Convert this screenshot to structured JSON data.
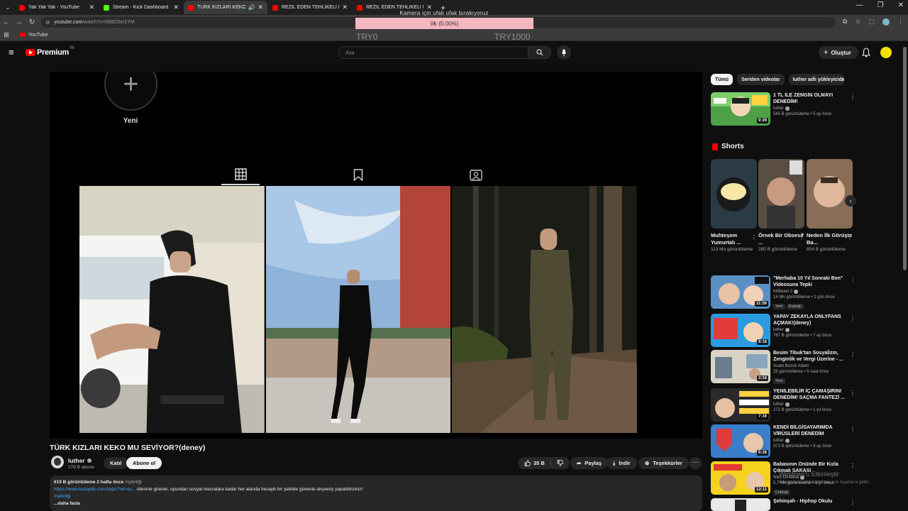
{
  "browser": {
    "tabs": [
      {
        "title": "Yak Yak Yak - YouTube",
        "favicon": "youtube-icon",
        "active": false
      },
      {
        "title": "Stream - Kick Dashboard",
        "favicon": "kick-icon",
        "active": false
      },
      {
        "title": "TÜRK KIZLARI KEKO MU SE",
        "favicon": "youtube-icon",
        "active": true
      },
      {
        "title": "REZİL EDEN TEHLİKELİ MASA O",
        "favicon": "youtube-icon",
        "active": false
      },
      {
        "title": "REZİL EDEN TEHLİKELİ MASA O",
        "favicon": "youtube-icon",
        "active": false
      }
    ],
    "url_host": "youtube.com",
    "url_path": "/watch?v=hf8825eI1YM",
    "bookmark": "YouTube"
  },
  "overlay": {
    "hint": "Kamera için ufak ufak bırakıyoruz",
    "progress_text": "0₺ (0.00%)",
    "progress_fraction": 0.0,
    "left_label": "TRY0",
    "right_label": "TRY1000"
  },
  "header": {
    "logo_text": "Premium",
    "logo_region": "TR",
    "search_placeholder": "Ara",
    "create_label": "Oluştur"
  },
  "player": {
    "new_label": "Yeni"
  },
  "video": {
    "title": "TÜRK KIZLARI KEKO MU SEVİYOR?(deney)",
    "channel": "luther",
    "subscribers": "279 B abone",
    "join_label": "Katıl",
    "subscribe_label": "Abone ol",
    "likes": "35 B",
    "share_label": "Paylaş",
    "download_label": "İndir",
    "thanks_label": "Teşekkürler",
    "views_date": "619 B görüntüleme  2 hafta önce",
    "hashtag": "#işbirliği",
    "desc_link": "https://www.hesaptik.com/login?ref=tu...",
    "desc_text": " sitesine girerek, oyundan sosyal mecralara kadar her alanda hesaplı bir şekilde güvenle alışveriş yapabilirsiniz!",
    "desc_hashtag2": "#işbirliği",
    "more_label": "...daha fazla"
  },
  "sidebar": {
    "chips": [
      "Tümü",
      "Seriden videolar",
      "luther adlı yükleyiciden"
    ],
    "top_rec": {
      "title": "1 TL İLE ZENGİN OLMAYI DENEDİM!",
      "channel": "luther",
      "views": "545 B görüntüleme • 5 ay önce",
      "duration": "9:39"
    },
    "shorts_title": "Shorts",
    "shorts": [
      {
        "title": "Muhteşem Yumurtalı ...",
        "views": "113 Mn görüntüleme"
      },
      {
        "title": "Örnek Bir Obsesif ...",
        "views": "280 B görüntüleme"
      },
      {
        "title": "Neden İlk Görüşte Ba...",
        "views": "804 B görüntüleme"
      }
    ],
    "recs": [
      {
        "title": "\"Merhaba 10 Yıl Sonraki Ben\" Videosuna Tepki",
        "channel": "MrBeast 2",
        "views": "14 Mn görüntüleme • 2 gün önce",
        "duration": "11:56",
        "badges": [
          "Yeni",
          "Dublajlı"
        ]
      },
      {
        "title": "YAPAY ZEKAYLA ONLYFANS AÇMAK!(deney)",
        "channel": "luther",
        "views": "767 B görüntüleme • 7 ay önce",
        "duration": "8:18",
        "badges": []
      },
      {
        "title": "Besim Tibuk'tan Sosyalizm, Zenginlik ve Vergi Üzerine - ...",
        "channel": "Asabi Bozuk Adam",
        "views": "25 görüntüleme • 5 saat önce",
        "duration": "3:16",
        "badges": [
          "Yeni"
        ]
      },
      {
        "title": "YENİLEBİLİR İÇ ÇAMAŞIRINI DENEDİM! SAÇMA FANTEZİ ...",
        "channel": "luther",
        "views": "272 B görüntüleme • 1 yıl önce",
        "duration": "7:16",
        "badges": []
      },
      {
        "title": "KENDİ BİLGİSAYARIMDA VİRÜSLERİ DENEDİM",
        "channel": "luther",
        "views": "373 B görüntüleme • 8 ay önce",
        "duration": "8:38",
        "badges": []
      },
      {
        "title": "Babasının Önünde Bir Kızla Çıkmak SAKASI",
        "channel": "Niko Omilana",
        "views": "5,7 Mn görüntüleme • 3 yıl önce",
        "duration": "12:11",
        "badges": [
          "Dublajlı"
        ]
      },
      {
        "title": "Şehinşah - Hiphop Okulu",
        "channel": "",
        "views": "",
        "duration": "",
        "badges": []
      }
    ],
    "windows_activate": "Windows'u Etkinleştir",
    "windows_activate_sub": "Windows'u etkinleştirmek için Ayarlar'a gidin."
  },
  "colors": {
    "accent": "#ff0000",
    "background": "#0f0f0f",
    "overlay_bar": "#f4b6bf",
    "link": "#3ea6ff"
  }
}
